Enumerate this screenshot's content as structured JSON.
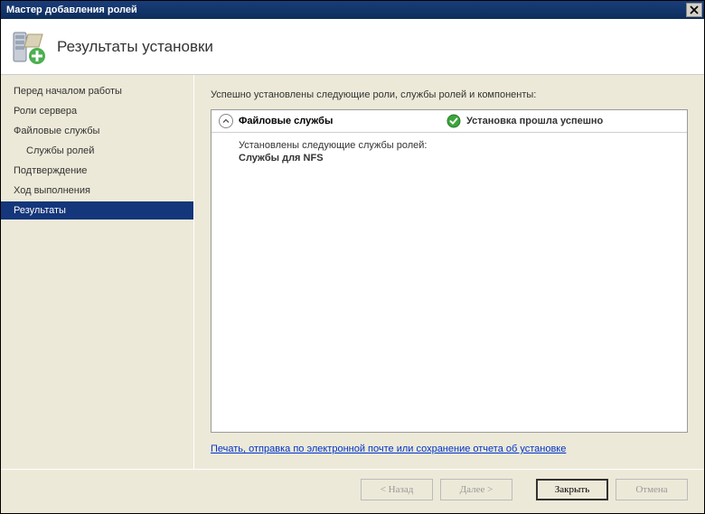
{
  "window": {
    "title": "Мастер добавления ролей"
  },
  "header": {
    "title": "Результаты установки"
  },
  "sidebar": {
    "items": [
      {
        "label": "Перед началом работы"
      },
      {
        "label": "Роли сервера"
      },
      {
        "label": "Файловые службы"
      },
      {
        "label": "Службы ролей"
      },
      {
        "label": "Подтверждение"
      },
      {
        "label": "Ход выполнения"
      },
      {
        "label": "Результаты"
      }
    ]
  },
  "main": {
    "intro": "Успешно установлены следующие роли, службы ролей и компоненты:",
    "result": {
      "title": "Файловые службы",
      "status": "Установка прошла успешно",
      "body_text": "Установлены следующие службы ролей:",
      "service": "Службы для NFS"
    },
    "link": "Печать, отправка по электронной почте или сохранение отчета об установке"
  },
  "footer": {
    "back": "< Назад",
    "next": "Далее >",
    "close": "Закрыть",
    "cancel": "Отмена"
  }
}
